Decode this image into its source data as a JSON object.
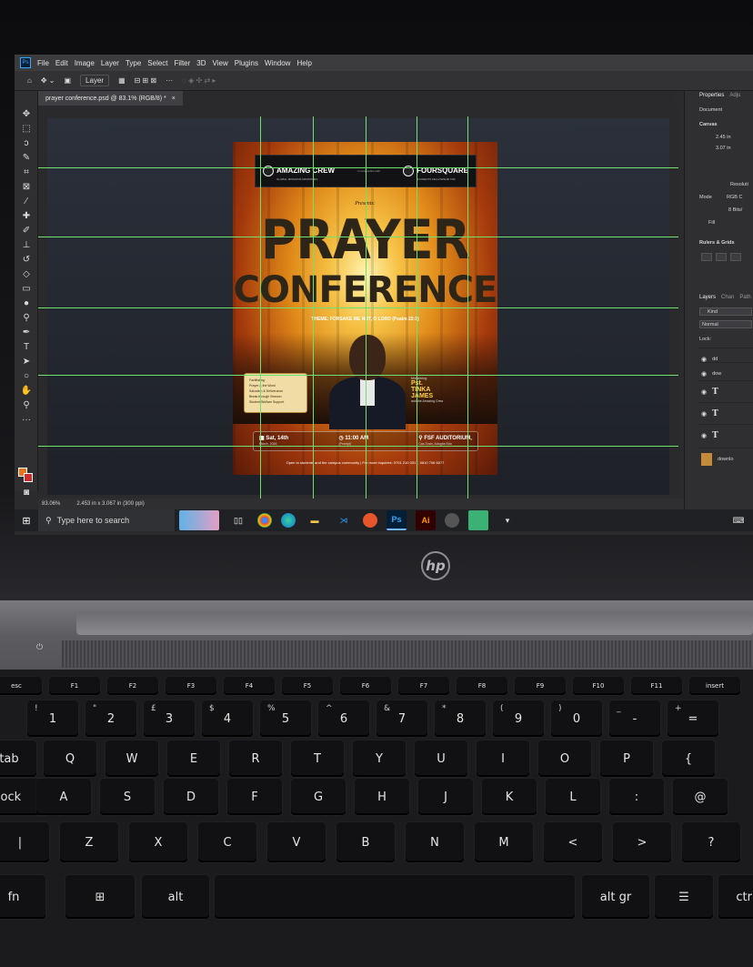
{
  "photoshop": {
    "menu": [
      "File",
      "Edit",
      "Image",
      "Layer",
      "Type",
      "Select",
      "Filter",
      "3D",
      "View",
      "Plugins",
      "Window",
      "Help"
    ],
    "options": {
      "layer_select": "Layer"
    },
    "tab_title": "prayer conference.psd @ 83.1% (RGB/8) *",
    "status_zoom": "83.06%",
    "status_doc": "2.453 in x 3.067 in (300 ppi)",
    "panels": {
      "tabs": [
        "Properties",
        "Adju"
      ],
      "document_label": "Document",
      "canvas_label": "Canvas",
      "width": "2.45 in",
      "height": "3.07 in",
      "resolution": "Resoluti",
      "mode_label": "Mode",
      "mode_value": "RGB C",
      "bits": "8 Bits/",
      "fill_label": "Fill",
      "rulers_label": "Rulers & Grids",
      "layers_tabs": [
        "Layers",
        "Chan",
        "Path"
      ],
      "kind": "Kind",
      "blend": "Normal",
      "lock": "Lock:",
      "layer_names": [
        "dd",
        "dow",
        "T",
        "T",
        "T",
        "downlo"
      ]
    }
  },
  "flyer": {
    "org_left": "AMAZING CREW",
    "org_left_sub": "GLOBAL MISSIONS MINISTRIES",
    "banner_mid": "In conjunction with",
    "org_right": "FOURSQUARE",
    "org_right_sub": "STUDENTS FELLOWSHIP FSF",
    "presents": "Presents:",
    "title_line1": "PRAYER",
    "title_line2": "CONFERENCE",
    "theme": "THEME: FORSAKE ME NOT, O LORD (Psalm 22:1)",
    "features": [
      "Facilitating:",
      "Prayer & the Word",
      "Salvation & Deliverance",
      "Break-through Session",
      "Student Welfare Support"
    ],
    "speaker_by": "Ministering:",
    "speaker_title": "Pst.",
    "speaker_name1": "TINKA",
    "speaker_name2": "JAMES",
    "speaker_crew": "and the Amazing Crew",
    "date": "Sat, 14th",
    "date2": "March, 2026",
    "time": "11:00 AM",
    "time2": "(Prompt)",
    "venue": "FSF AUDITORIUM,",
    "venue2": "Cas-Tosin, Adogba Edo",
    "footer_left": "Open to students and the campus community",
    "footer_right": "For more inquiries: 0701 210 0317, 0810 706 6077"
  },
  "taskbar": {
    "search_placeholder": "Type here to search",
    "apps": [
      "Task View",
      "Chrome",
      "Edge",
      "File Explorer",
      "VS Code",
      "Snip",
      "Ps",
      "Ai",
      "App",
      "App",
      "App"
    ]
  },
  "laptop": {
    "brand": "hp"
  },
  "keyboard": {
    "row_fn": [
      "esc",
      "F1",
      "F2",
      "F3",
      "F4",
      "F5",
      "F6",
      "F7",
      "F8",
      "F9",
      "F10",
      "F11",
      "insert"
    ],
    "row_num": [
      "!",
      "\"",
      "£",
      "$",
      "%",
      "^",
      "&",
      "*",
      "(",
      ")",
      "_",
      "+"
    ],
    "row_num_lower": [
      "1",
      "2",
      "3",
      "4",
      "5",
      "6",
      "7",
      "8",
      "9",
      "0",
      "-",
      "="
    ],
    "row_q": [
      "tab",
      "Q",
      "W",
      "E",
      "R",
      "T",
      "Y",
      "U",
      "I",
      "O",
      "P",
      "{"
    ],
    "row_a": [
      "lock",
      "A",
      "S",
      "D",
      "F",
      "G",
      "H",
      "J",
      "K",
      "L",
      ":",
      "@"
    ],
    "row_z": [
      "|",
      "Z",
      "X",
      "C",
      "V",
      "B",
      "N",
      "M",
      "<",
      ">",
      "?"
    ],
    "row_space": [
      "fn",
      "win",
      "alt",
      "",
      "alt gr",
      "menu",
      "ctrl"
    ]
  }
}
